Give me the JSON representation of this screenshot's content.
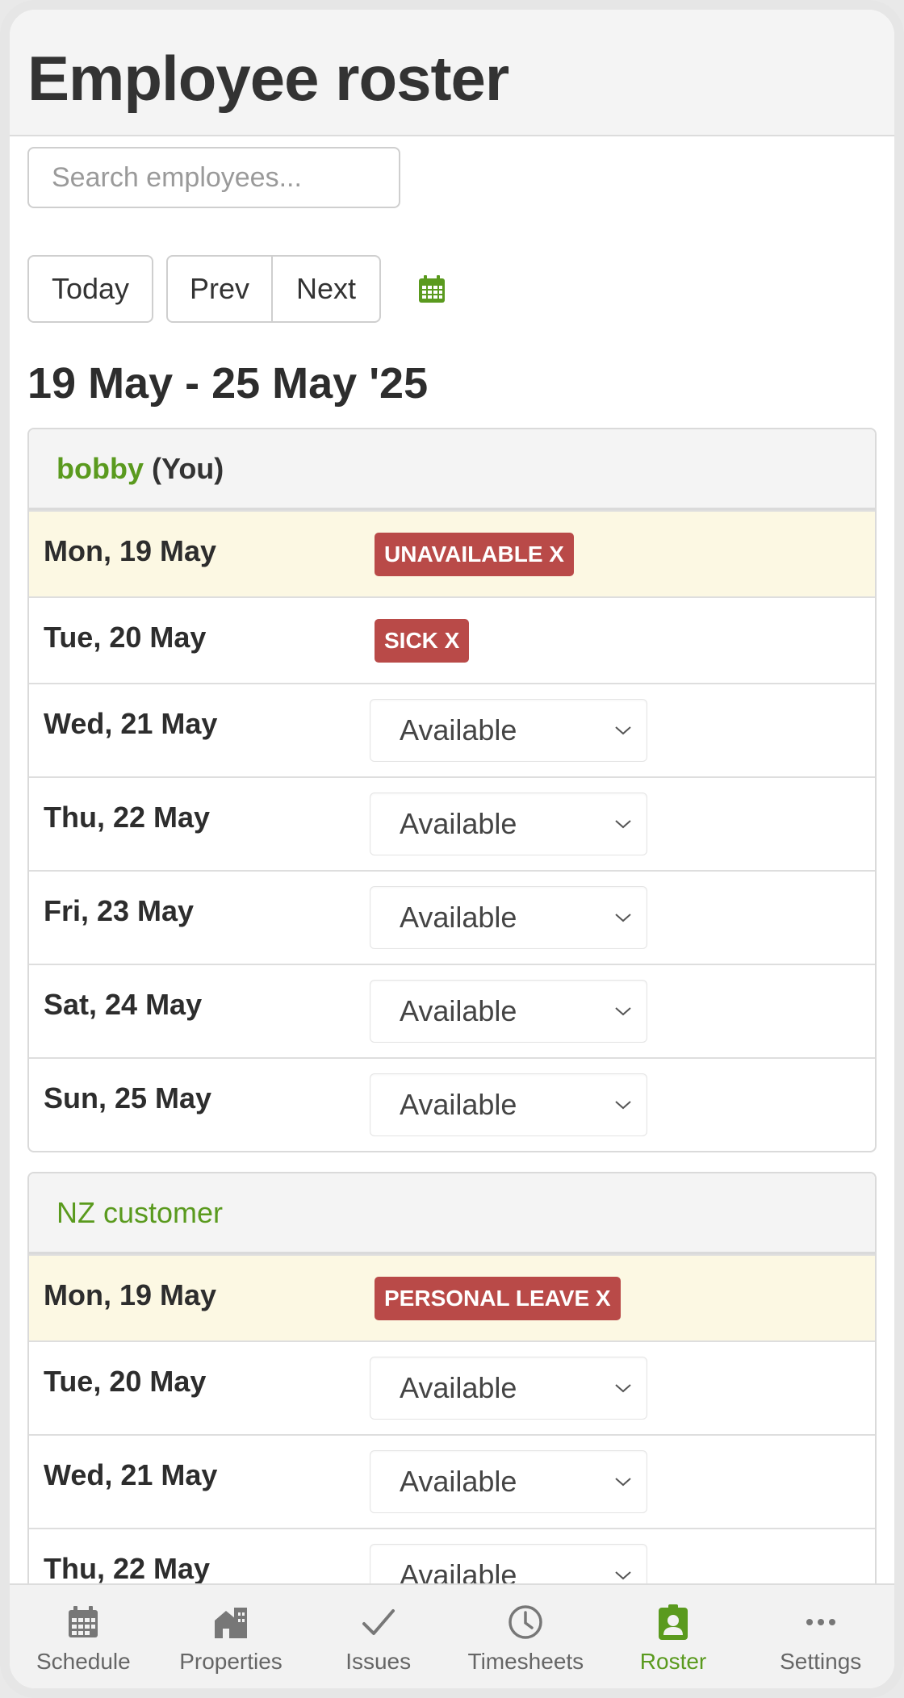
{
  "header": {
    "title": "Employee roster"
  },
  "search": {
    "placeholder": "Search employees..."
  },
  "toolbar": {
    "today": "Today",
    "prev": "Prev",
    "next": "Next",
    "calendar_icon": "calendar-icon"
  },
  "date_range": "19 May - 25 May '25",
  "colors": {
    "accent": "#5a9a1e",
    "danger": "#b94a48",
    "today_bg": "#fcf8e3"
  },
  "groups": [
    {
      "name": "bobby",
      "suffix": "(You)",
      "rows": [
        {
          "day": "Mon, 19 May",
          "badge": "UNAVAILABLE X"
        },
        {
          "day": "Tue, 20 May",
          "badge": "SICK X"
        },
        {
          "day": "Wed, 21 May",
          "select": "Available"
        },
        {
          "day": "Thu, 22 May",
          "select": "Available"
        },
        {
          "day": "Fri, 23 May",
          "select": "Available"
        },
        {
          "day": "Sat, 24 May",
          "select": "Available"
        },
        {
          "day": "Sun, 25 May",
          "select": "Available"
        }
      ]
    },
    {
      "name": "NZ customer",
      "rows": [
        {
          "day": "Mon, 19 May",
          "badge": "PERSONAL LEAVE X"
        },
        {
          "day": "Tue, 20 May",
          "select": "Available"
        },
        {
          "day": "Wed, 21 May",
          "select": "Available"
        },
        {
          "day": "Thu, 22 May",
          "select": "Available"
        }
      ]
    }
  ],
  "tabs": [
    {
      "label": "Schedule",
      "icon": "calendar-icon"
    },
    {
      "label": "Properties",
      "icon": "building-icon"
    },
    {
      "label": "Issues",
      "icon": "checkmark-icon"
    },
    {
      "label": "Timesheets",
      "icon": "clock-icon"
    },
    {
      "label": "Roster",
      "icon": "id-badge-icon",
      "active": true
    },
    {
      "label": "Settings",
      "icon": "ellipsis-icon"
    }
  ]
}
